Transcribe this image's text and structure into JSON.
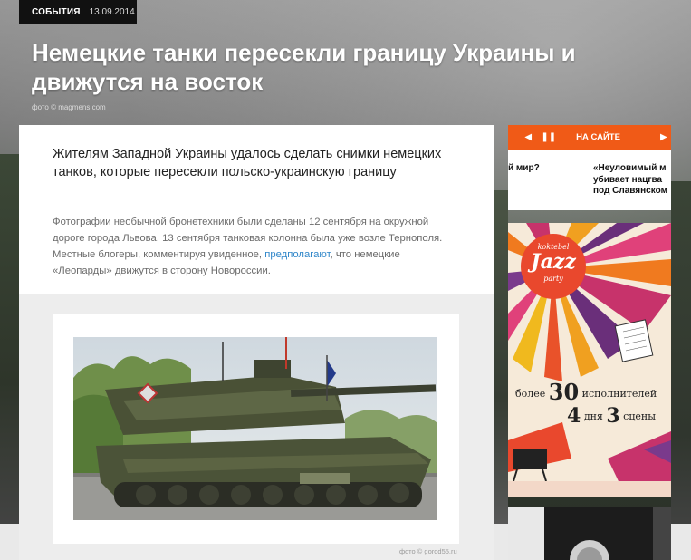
{
  "topbar": {
    "category": "СОБЫТИЯ",
    "date": "13.09.2014"
  },
  "article": {
    "title": "Немецкие танки пересекли границу Украины и движутся на восток",
    "hero_credit": "фото © magmens.com",
    "lead": "Жителям Западной Украины удалось сделать снимки немецких танков, которые пересекли польско-украинскую границу",
    "body_part1": "Фотографии необычной бронетехники были сделаны 12 сентября на окружной дороге города Львова. 13 сентября танковая колонна была уже возле Тернополя. Местные блогеры, комментируя увиденное,",
    "body_link": "предполагают",
    "body_part2": ", что немецкие «Леопарды» движутся в сторону Новороссии.",
    "image_credit": "фото © gorod55.ru"
  },
  "ticker": {
    "label": "НА САЙТЕ",
    "prev_icon": "play-left-icon",
    "pause_icon": "pause-icon",
    "next_icon": "play-right-icon",
    "item1": "й мир?",
    "item2_line1": "«Неуловимый м",
    "item2_line2": "убивает нацгва",
    "item2_line3": "под Славянском"
  },
  "ad": {
    "logo_top": "koktebel",
    "logo_main": "Jazz",
    "logo_sub": "party",
    "line1_prefix": "более",
    "line1_number": "30",
    "line1_suffix": "исполнителей",
    "line2_number1": "4",
    "line2_word1": "дня",
    "line2_number2": "3",
    "line2_word2": "сцены"
  },
  "colors": {
    "accent": "#f05a17",
    "link": "#2f86c9"
  }
}
